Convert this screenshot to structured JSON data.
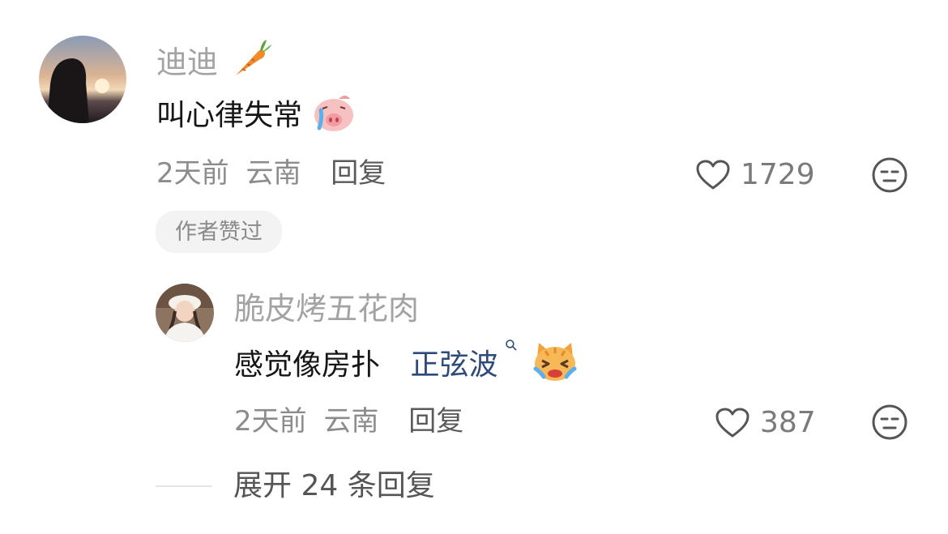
{
  "comments": [
    {
      "username": "迪迪",
      "username_emoji": "carrot-icon",
      "text": "叫心律失常",
      "text_emoji": "crying-pig-emoji",
      "time": "2天前",
      "location": "云南",
      "reply_label": "回复",
      "likes": "1729",
      "badge": "作者赞过"
    },
    {
      "username": "脆皮烤五花肉",
      "text": "感觉像房扑",
      "mention": "正弦波",
      "mention_icon": "search-icon",
      "text_emoji": "crying-cat-emoji",
      "time": "2天前",
      "location": "云南",
      "reply_label": "回复",
      "likes": "387"
    }
  ],
  "expand_label": "展开 24 条回复",
  "colors": {
    "username": "#a3a3a3",
    "text": "#161616",
    "mention": "#2d4a7a",
    "meta": "#8c8c8c"
  }
}
